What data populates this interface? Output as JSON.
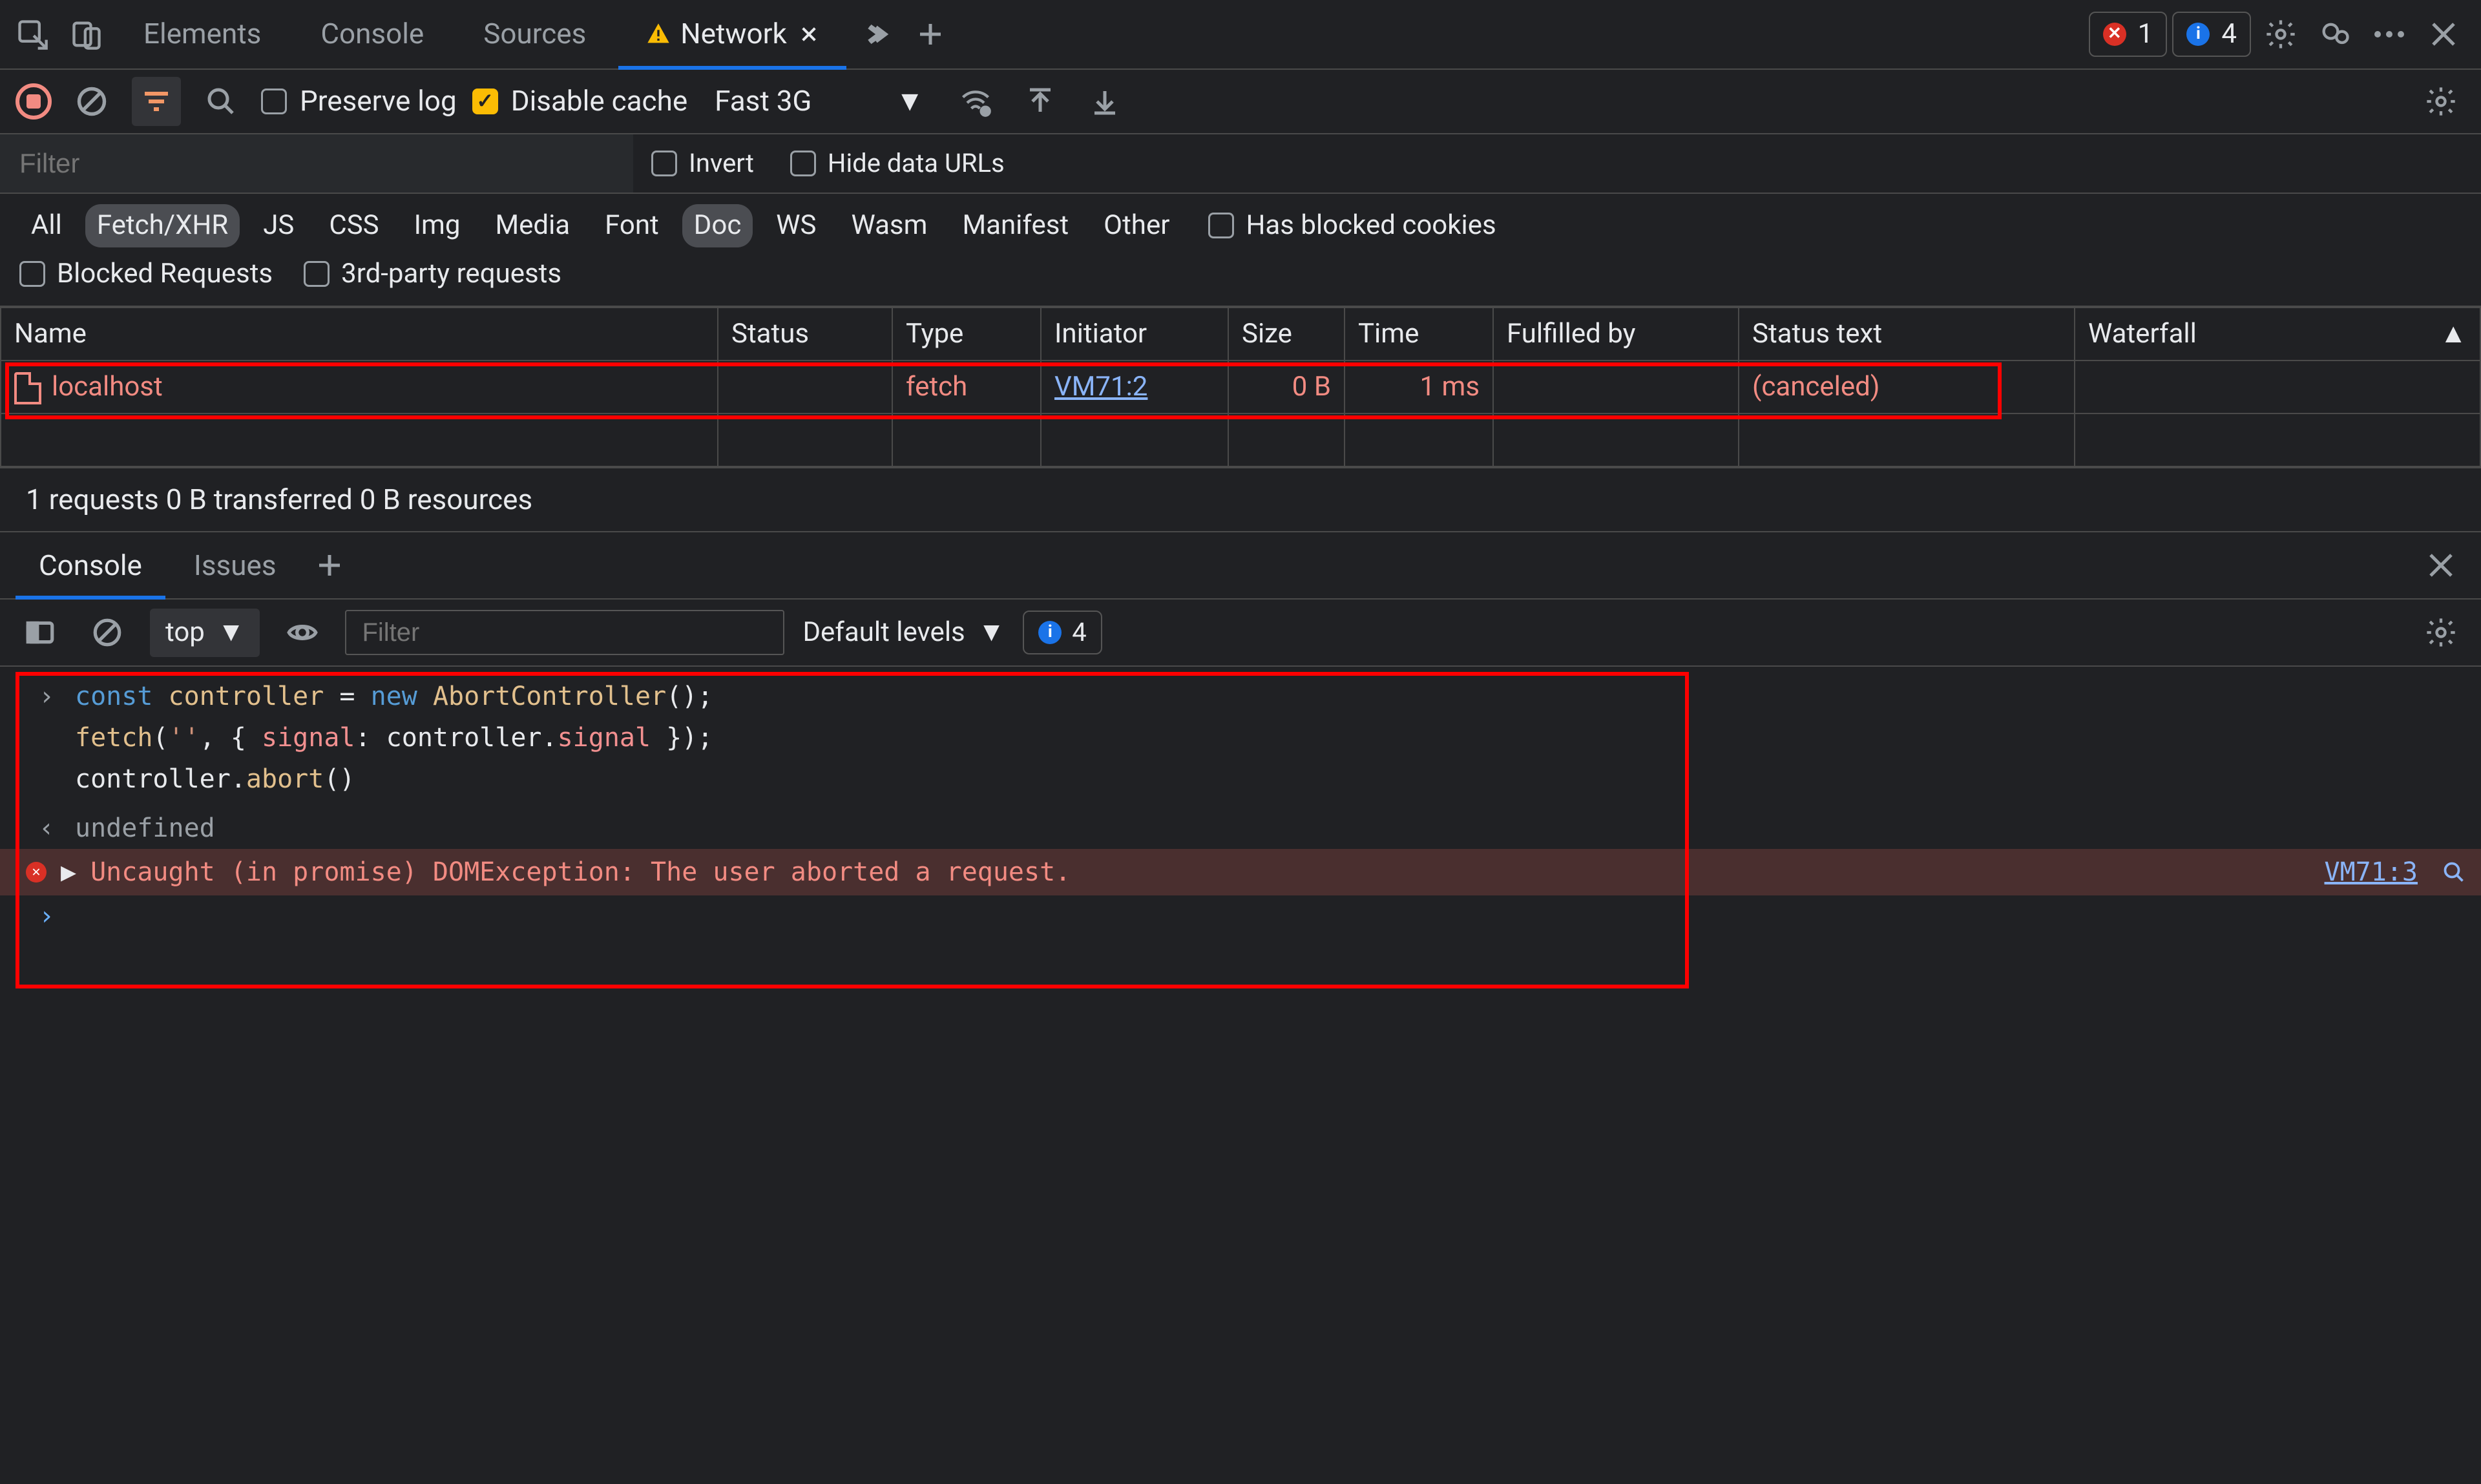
{
  "topbar": {
    "tabs": [
      "Elements",
      "Console",
      "Sources",
      "Network"
    ],
    "active_tab": "Network",
    "error_count": "1",
    "info_count": "4"
  },
  "toolbar": {
    "preserve_log": "Preserve log",
    "disable_cache": "Disable cache",
    "throttle": "Fast 3G"
  },
  "filterbar": {
    "filter_placeholder": "Filter",
    "invert": "Invert",
    "hide_data_urls": "Hide data URLs"
  },
  "types": {
    "items": [
      "All",
      "Fetch/XHR",
      "JS",
      "CSS",
      "Img",
      "Media",
      "Font",
      "Doc",
      "WS",
      "Wasm",
      "Manifest",
      "Other"
    ],
    "selected": [
      "Fetch/XHR",
      "Doc"
    ],
    "has_blocked_cookies": "Has blocked cookies",
    "blocked_requests": "Blocked Requests",
    "third_party": "3rd-party requests"
  },
  "table": {
    "headers": [
      "Name",
      "Status",
      "Type",
      "Initiator",
      "Size",
      "Time",
      "Fulfilled by",
      "Status text",
      "Waterfall"
    ],
    "rows": [
      {
        "name": "localhost",
        "status": "",
        "type": "fetch",
        "initiator": "VM71:2",
        "size": "0 B",
        "time": "1 ms",
        "fulfilled_by": "",
        "status_text": "(canceled)"
      }
    ]
  },
  "statusbar": {
    "text": "1 requests   0 B transferred   0 B resources"
  },
  "drawer": {
    "tabs": [
      "Console",
      "Issues"
    ],
    "active": "Console"
  },
  "console_tb": {
    "context": "top",
    "filter_placeholder": "Filter",
    "levels": "Default levels",
    "info_count": "4"
  },
  "console": {
    "input_lines": [
      "const controller = new AbortController();",
      "fetch('', { signal: controller.signal });",
      "controller.abort()"
    ],
    "result": "undefined",
    "error": {
      "msg": "Uncaught (in promise) DOMException: The user aborted a request.",
      "src": "VM71:3"
    }
  }
}
